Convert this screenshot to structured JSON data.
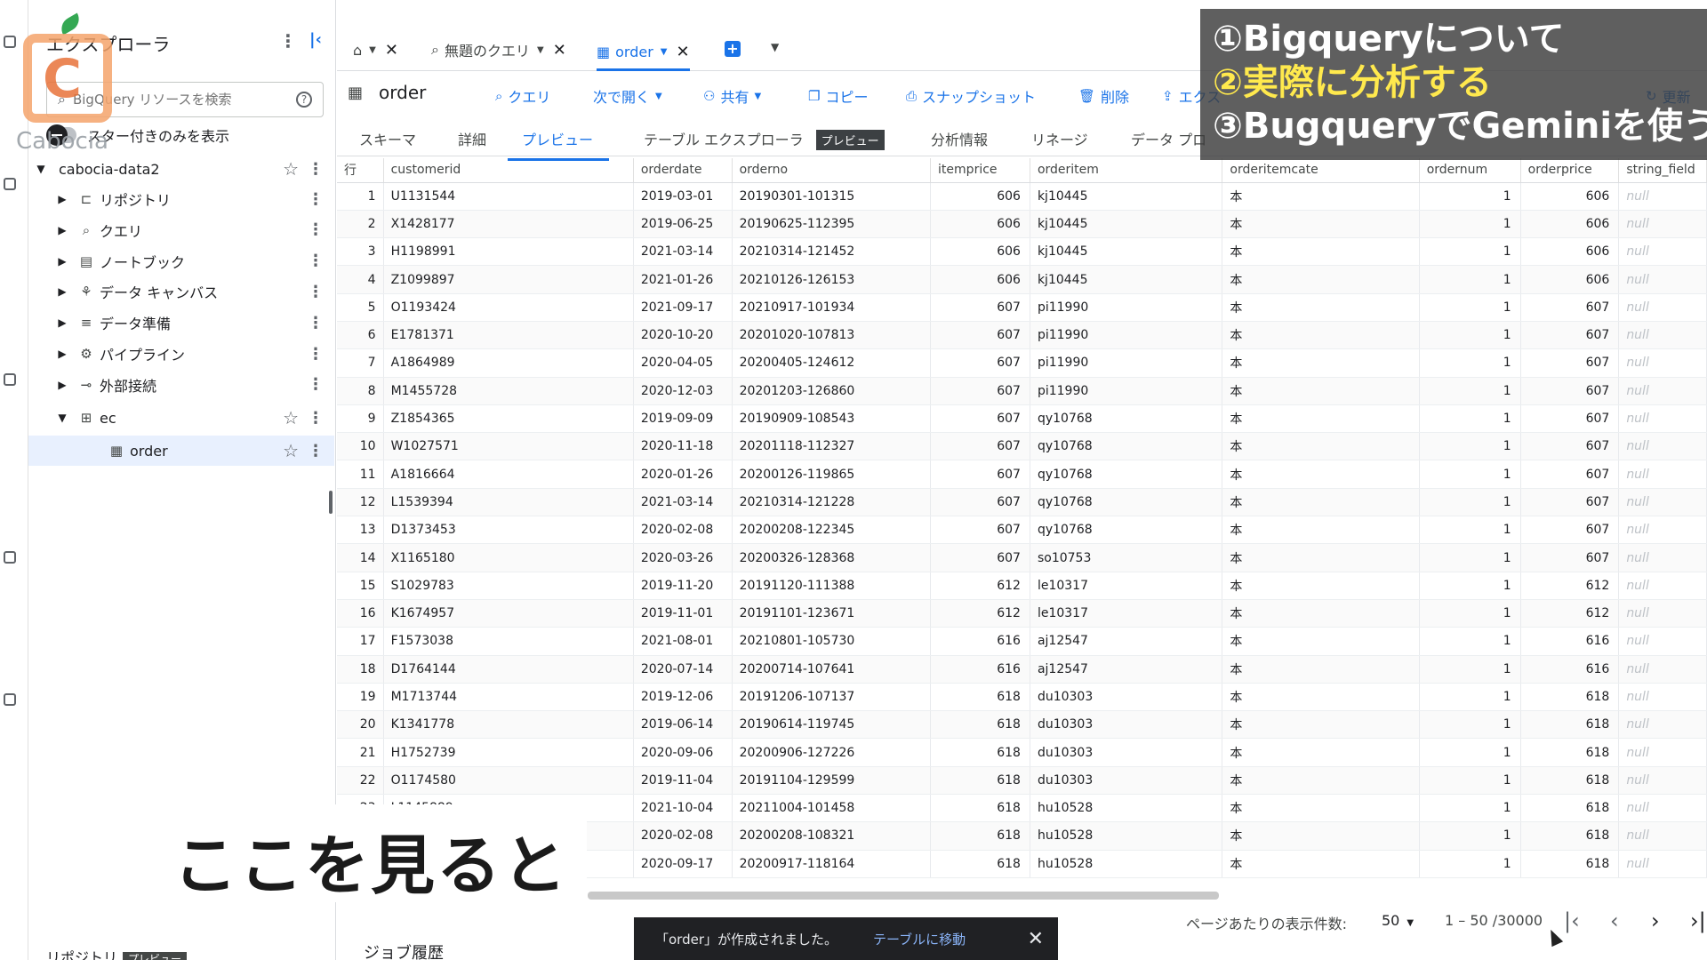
{
  "explorer": {
    "title": "エクスプローラ",
    "search_placeholder": "BigQuery リソースを検索",
    "star_toggle_label": "スター付きのみを表示",
    "project": "cabocia-data2",
    "items": [
      {
        "label": "リポジトリ",
        "icon": "repository-icon"
      },
      {
        "label": "クエリ",
        "icon": "query-icon"
      },
      {
        "label": "ノートブック",
        "icon": "notebook-icon"
      },
      {
        "label": "データ キャンバス",
        "icon": "canvas-icon"
      },
      {
        "label": "データ準備",
        "icon": "data-prep-icon"
      },
      {
        "label": "パイプライン",
        "icon": "pipeline-icon"
      },
      {
        "label": "外部接続",
        "icon": "connection-icon"
      }
    ],
    "dataset": "ec",
    "table": "order",
    "bottom_label": "リポジトリ",
    "bottom_badge": "プレビュー"
  },
  "logo": {
    "word": "Cabocia",
    "letter": "C"
  },
  "tabs": {
    "untitled_query": "無題のクエリ",
    "order": "order"
  },
  "toolbar": {
    "title": "order",
    "query": "クエリ",
    "open_next": "次で開く",
    "share": "共有",
    "copy": "コピー",
    "snapshot": "スナップショット",
    "delete": "削除",
    "export": "エクス",
    "refresh": "更新"
  },
  "subtabs": {
    "schema": "スキーマ",
    "details": "詳細",
    "preview": "プレビュー",
    "table_explorer": "テーブル エクスプローラ",
    "table_explorer_badge": "プレビュー",
    "insights": "分析情報",
    "lineage": "リネージ",
    "data_profile": "データ プロ"
  },
  "grid": {
    "columns": [
      "行",
      "customerid",
      "orderdate",
      "orderno",
      "itemprice",
      "orderitem",
      "orderitemcate",
      "ordernum",
      "orderprice",
      "string_field"
    ],
    "rows": [
      [
        "1",
        "U1131544",
        "2019-03-01",
        "20190301-101315",
        "606",
        "kj10445",
        "本",
        "1",
        "606",
        "null"
      ],
      [
        "2",
        "X1428177",
        "2019-06-25",
        "20190625-112395",
        "606",
        "kj10445",
        "本",
        "1",
        "606",
        "null"
      ],
      [
        "3",
        "H1198991",
        "2021-03-14",
        "20210314-121452",
        "606",
        "kj10445",
        "本",
        "1",
        "606",
        "null"
      ],
      [
        "4",
        "Z1099897",
        "2021-01-26",
        "20210126-126153",
        "606",
        "kj10445",
        "本",
        "1",
        "606",
        "null"
      ],
      [
        "5",
        "O1193424",
        "2021-09-17",
        "20210917-101934",
        "607",
        "pi11990",
        "本",
        "1",
        "607",
        "null"
      ],
      [
        "6",
        "E1781371",
        "2020-10-20",
        "20201020-107813",
        "607",
        "pi11990",
        "本",
        "1",
        "607",
        "null"
      ],
      [
        "7",
        "A1864989",
        "2020-04-05",
        "20200405-124612",
        "607",
        "pi11990",
        "本",
        "1",
        "607",
        "null"
      ],
      [
        "8",
        "M1455728",
        "2020-12-03",
        "20201203-126860",
        "607",
        "pi11990",
        "本",
        "1",
        "607",
        "null"
      ],
      [
        "9",
        "Z1854365",
        "2019-09-09",
        "20190909-108543",
        "607",
        "qy10768",
        "本",
        "1",
        "607",
        "null"
      ],
      [
        "10",
        "W1027571",
        "2020-11-18",
        "20201118-112327",
        "607",
        "qy10768",
        "本",
        "1",
        "607",
        "null"
      ],
      [
        "11",
        "A1816664",
        "2020-01-26",
        "20200126-119865",
        "607",
        "qy10768",
        "本",
        "1",
        "607",
        "null"
      ],
      [
        "12",
        "L1539394",
        "2021-03-14",
        "20210314-121228",
        "607",
        "qy10768",
        "本",
        "1",
        "607",
        "null"
      ],
      [
        "13",
        "D1373453",
        "2020-02-08",
        "20200208-122345",
        "607",
        "qy10768",
        "本",
        "1",
        "607",
        "null"
      ],
      [
        "14",
        "X1165180",
        "2020-03-26",
        "20200326-128368",
        "607",
        "so10753",
        "本",
        "1",
        "607",
        "null"
      ],
      [
        "15",
        "S1029783",
        "2019-11-20",
        "20191120-111388",
        "612",
        "le10317",
        "本",
        "1",
        "612",
        "null"
      ],
      [
        "16",
        "K1674957",
        "2019-11-01",
        "20191101-123671",
        "612",
        "le10317",
        "本",
        "1",
        "612",
        "null"
      ],
      [
        "17",
        "F1573038",
        "2021-08-01",
        "20210801-105730",
        "616",
        "aj12547",
        "本",
        "1",
        "616",
        "null"
      ],
      [
        "18",
        "D1764144",
        "2020-07-14",
        "20200714-107641",
        "616",
        "aj12547",
        "本",
        "1",
        "616",
        "null"
      ],
      [
        "19",
        "M1713744",
        "2019-12-06",
        "20191206-107137",
        "618",
        "du10303",
        "本",
        "1",
        "618",
        "null"
      ],
      [
        "20",
        "K1341778",
        "2019-06-14",
        "20190614-119745",
        "618",
        "du10303",
        "本",
        "1",
        "618",
        "null"
      ],
      [
        "21",
        "H1752739",
        "2020-09-06",
        "20200906-127226",
        "618",
        "du10303",
        "本",
        "1",
        "618",
        "null"
      ],
      [
        "22",
        "O1174580",
        "2019-11-04",
        "20191104-129599",
        "618",
        "du10303",
        "本",
        "1",
        "618",
        "null"
      ],
      [
        "23",
        "L1145889",
        "2021-10-04",
        "20211004-101458",
        "618",
        "hu10528",
        "本",
        "1",
        "618",
        "null"
      ],
      [
        "24",
        "",
        "2020-02-08",
        "20200208-108321",
        "618",
        "hu10528",
        "本",
        "1",
        "618",
        "null"
      ],
      [
        "25",
        "",
        "2020-09-17",
        "20200917-118164",
        "618",
        "hu10528",
        "本",
        "1",
        "618",
        "null"
      ]
    ]
  },
  "pager": {
    "label": "ページあたりの表示件数:",
    "size": "50",
    "range": "1 – 50 /30000"
  },
  "job_history": "ジョブ履歴",
  "snackbar": {
    "message": "「order」が作成されました。",
    "action": "テーブルに移動"
  },
  "overlay": {
    "line1": "①Bigqueryについて",
    "line2": "②実際に分析する",
    "line3": "③BugqueryでGeminiを使う"
  },
  "caption": "ここを見ると"
}
